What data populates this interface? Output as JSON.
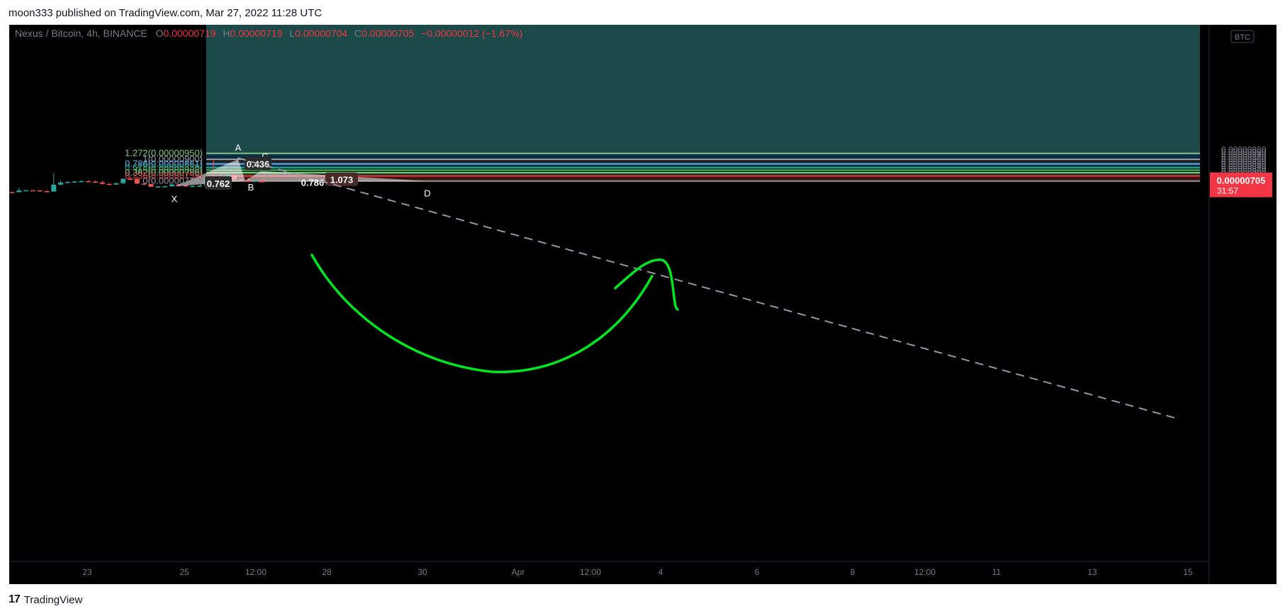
{
  "header": {
    "published": "moon333 published on TradingView.com, Mar 27, 2022 11:28 UTC"
  },
  "legend": {
    "symbol": "Nexus / Bitcoin, 4h, BINANCE",
    "o_label": "O",
    "o_value": "0.00000719",
    "h_label": "H",
    "h_value": "0.00000719",
    "l_label": "L",
    "l_value": "0.00000704",
    "c_label": "C",
    "c_value": "0.00000705",
    "change": "−0.00000012 (−1.67%)"
  },
  "currency_badge": "BTC",
  "last_price": {
    "value": "0.00000705",
    "countdown": "31:57"
  },
  "footer": {
    "brand": "TradingView"
  },
  "chart_data": {
    "type": "candlestick",
    "y_axis": {
      "min": 6.05e-06,
      "max": 9.9e-06,
      "ticks": [
        "0.00000980",
        "0.00000960",
        "0.00000940",
        "0.00000920",
        "0.00000900",
        "0.00000880",
        "0.00000860",
        "0.00000840",
        "0.00000820",
        "0.00000800",
        "0.00000780",
        "0.00000760",
        "0.00000740",
        "0.00000720",
        "0.00000700",
        "0.00000680",
        "0.00000660",
        "0.00000640",
        "0.00000620"
      ]
    },
    "x_axis": {
      "ticks": [
        "23",
        "25",
        "12:00",
        "28",
        "30",
        "Apr",
        "12:00",
        "4",
        "6",
        "8",
        "12:00",
        "11",
        "13",
        "15"
      ]
    },
    "fib_levels": [
      {
        "label": "1.272(0.00000950)",
        "price": 9.5e-06,
        "color": "#81c784"
      },
      {
        "label": "1(0.00000900)",
        "price": 9e-06,
        "color": "#9598a1"
      },
      {
        "label": "0.786(0.00000861)",
        "price": 8.61e-06,
        "color": "#64b5f6"
      },
      {
        "label": "0.618(0.00000830)",
        "price": 8.3e-06,
        "color": "#22ab94"
      },
      {
        "label": "0.5(0.00000808)",
        "price": 8.08e-06,
        "color": "#4caf50"
      },
      {
        "label": "0.382(0.00000786)",
        "price": 7.86e-06,
        "color": "#81c784"
      },
      {
        "label": "0.236(0.00000759)",
        "price": 7.59e-06,
        "color": "#f23645"
      },
      {
        "label": "0(0.00000716)",
        "price": 7.16e-06,
        "color": "#9598a1"
      }
    ],
    "pattern_points": [
      {
        "label": "X",
        "price": 6.7e-06
      },
      {
        "label": "A",
        "price": 9e-06
      },
      {
        "label": "B",
        "price": 7.2e-06
      },
      {
        "label": "C",
        "price": 8e-06
      },
      {
        "label": "D",
        "price": 7.16e-06
      }
    ],
    "pattern_ratios": [
      "0.762",
      "0.436",
      "1.073",
      "0.786"
    ],
    "candles": [
      [
        6.23e-06,
        6.24e-06,
        6.21e-06,
        6.22e-06
      ],
      [
        6.22e-06,
        6.6e-06,
        6.18e-06,
        6.37e-06
      ],
      [
        6.37e-06,
        6.4e-06,
        6.35e-06,
        6.38e-06
      ],
      [
        6.38e-06,
        6.39e-06,
        6.36e-06,
        6.37e-06
      ],
      [
        6.37e-06,
        6.4e-06,
        6.28e-06,
        6.3e-06
      ],
      [
        6.3e-06,
        6.4e-06,
        6.25e-06,
        6.27e-06
      ],
      [
        6.27e-06,
        7.85e-06,
        6.25e-06,
        6.85e-06
      ],
      [
        6.85e-06,
        7.2e-06,
        6.8e-06,
        7.04e-06
      ],
      [
        7.04e-06,
        7.12e-06,
        6.98e-06,
        7.08e-06
      ],
      [
        7.08e-06,
        7.18e-06,
        7.02e-06,
        7.13e-06
      ],
      [
        7.13e-06,
        7.25e-06,
        7.08e-06,
        7.15e-06
      ],
      [
        7.15e-06,
        7.25e-06,
        7.1e-06,
        7.12e-06
      ],
      [
        7.12e-06,
        7.2e-06,
        7e-06,
        7.05e-06
      ],
      [
        7.05e-06,
        7.2e-06,
        6.85e-06,
        6.92e-06
      ],
      [
        6.92e-06,
        7e-06,
        6.82e-06,
        6.86e-06
      ],
      [
        6.86e-06,
        7e-06,
        6.84e-06,
        6.98e-06
      ],
      [
        6.98e-06,
        7.4e-06,
        6.9e-06,
        7.35e-06
      ],
      [
        7.35e-06,
        7.5e-06,
        7.25e-06,
        7.33e-06
      ],
      [
        7.33e-06,
        7.55e-06,
        6.9e-06,
        6.95e-06
      ],
      [
        6.95e-06,
        7e-06,
        6.85e-06,
        6.91e-06
      ],
      [
        6.91e-06,
        6.92e-06,
        6.66e-06,
        6.68e-06
      ],
      [
        6.68e-06,
        6.72e-06,
        6.64e-06,
        6.7e-06
      ],
      [
        6.7e-06,
        6.75e-06,
        6.68e-06,
        6.72e-06
      ],
      [
        6.72e-06,
        6.9e-06,
        6.68e-06,
        6.88e-06
      ],
      [
        6.88e-06,
        6.95e-06,
        6.76e-06,
        6.8e-06
      ],
      [
        6.8e-06,
        6.84e-06,
        6.66e-06,
        6.7e-06
      ],
      [
        6.7e-06,
        6.78e-06,
        6.66e-06,
        6.74e-06
      ],
      [
        6.74e-06,
        6.8e-06,
        6.7e-06,
        6.76e-06
      ],
      [
        6.76e-06,
        7.5e-06,
        6.74e-06,
        7.45e-06
      ],
      [
        7.45e-06,
        9e-06,
        7.3e-06,
        7.26e-06
      ],
      [
        7.26e-06,
        7.7e-06,
        7.18e-06,
        7.32e-06
      ],
      [
        7.32e-06,
        7.9e-06,
        7.25e-06,
        7.65e-06
      ],
      [
        7.65e-06,
        7.95e-06,
        7.25e-06,
        7.28e-06
      ],
      [
        7.28e-06,
        7.4e-06,
        7.22e-06,
        7.24e-06
      ],
      [
        7.24e-06,
        7.45e-06,
        7.1e-06,
        7.12e-06
      ],
      [
        7.12e-06,
        7.25e-06,
        7.08e-06,
        7.2e-06
      ],
      [
        7.2e-06,
        7.22e-06,
        7.08e-06,
        7.05e-06
      ]
    ]
  }
}
